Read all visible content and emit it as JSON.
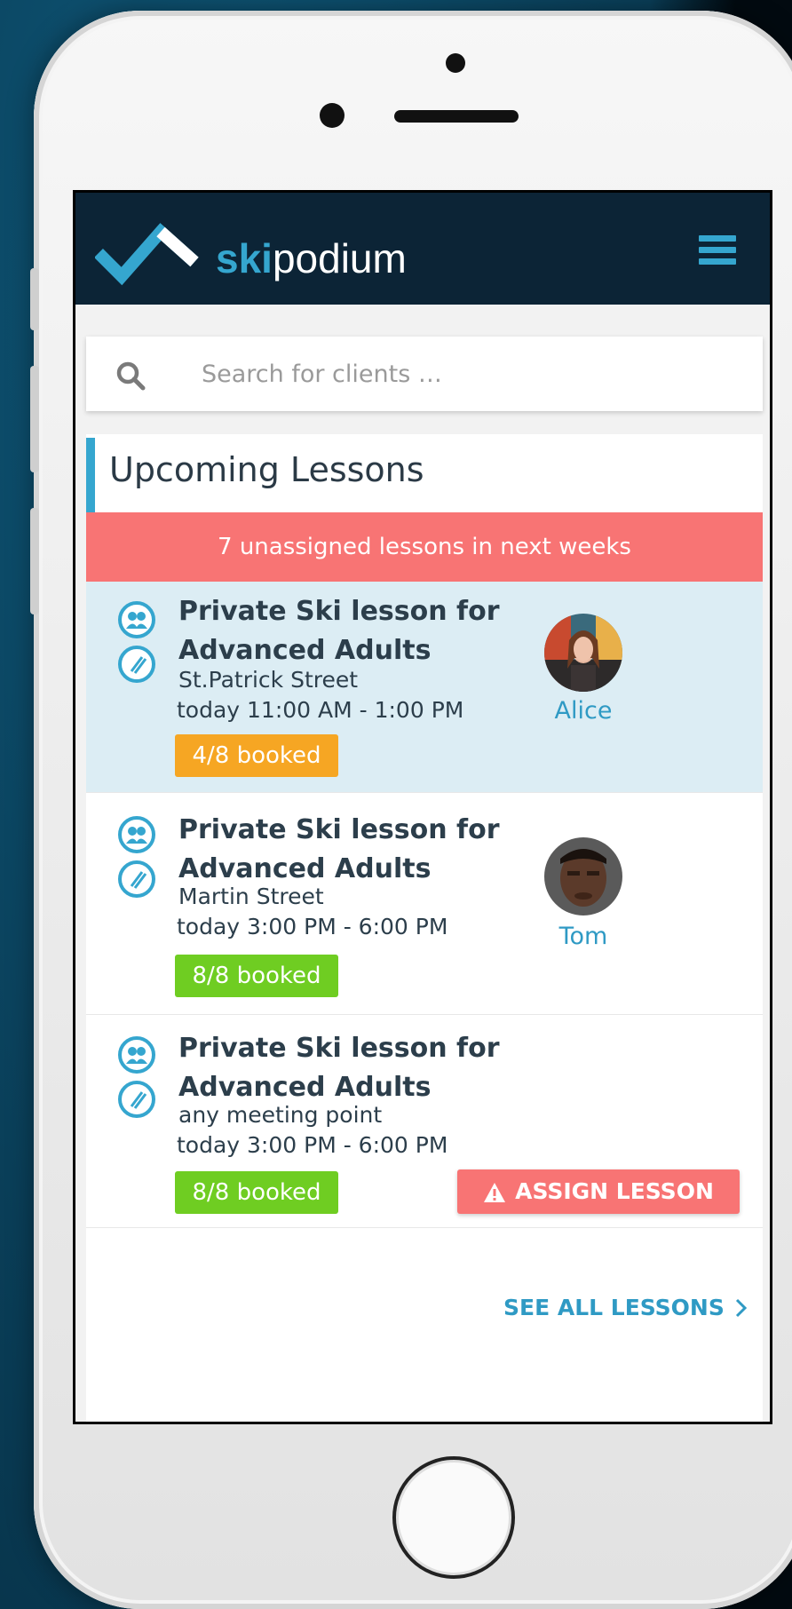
{
  "app": {
    "logo_text_ski": "ski",
    "logo_text_podium": "podium",
    "menu_icon": "hamburger-menu-icon"
  },
  "search": {
    "placeholder": "Search for clients …",
    "icon": "search-icon"
  },
  "lessons": {
    "section_title": "Upcoming Lessons",
    "alert_text": "7 unassigned lessons in next weeks",
    "items": [
      {
        "title": "Private Ski lesson for Advanced Adults",
        "place": "St.Patrick Street",
        "time": "today 11:00 AM - 1:00 PM",
        "booked": "4/8 booked",
        "booked_status": "partial",
        "instructor": "Alice",
        "highlighted": true
      },
      {
        "title": "Private Ski lesson for Advanced Adults",
        "place": "Martin Street",
        "time": "today 3:00 PM - 6:00 PM",
        "booked": "8/8 booked",
        "booked_status": "full",
        "instructor": "Tom",
        "highlighted": false
      },
      {
        "title": "Private Ski lesson for Advanced Adults",
        "place": "any meeting point",
        "time": "today 3:00 PM - 6:00 PM",
        "booked": "8/8 booked",
        "booked_status": "full",
        "assign_label": "ASSIGN LESSON",
        "highlighted": false
      }
    ],
    "see_all_label": "SEE ALL LESSONS"
  },
  "colors": {
    "header_bg": "#0c2436",
    "accent": "#35a6cf",
    "alert": "#f87474",
    "badge_partial": "#f6a623",
    "badge_full": "#6fcd22",
    "highlight_row": "#dcedf4"
  }
}
